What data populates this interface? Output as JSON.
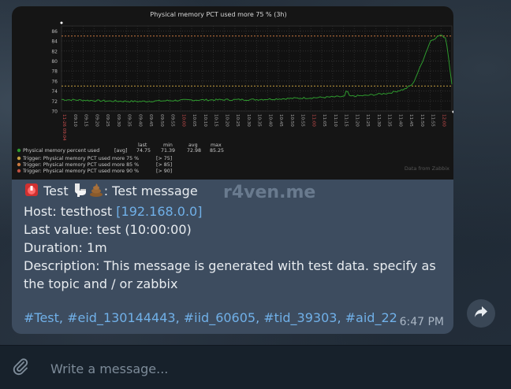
{
  "graph": {
    "title": "Physical memory PCT used more 75 % (3h)",
    "y_ticks": [
      "86",
      "84",
      "82",
      "80",
      "78",
      "76",
      "74",
      "72",
      "70"
    ],
    "x_ticks": [
      "11-26 09:04",
      "09:10",
      "09:15",
      "09:20",
      "09:25",
      "09:30",
      "09:35",
      "09:40",
      "09:45",
      "09:50",
      "09:55",
      "10:00",
      "10:05",
      "10:10",
      "10:15",
      "10:20",
      "10:25",
      "10:30",
      "10:35",
      "10:40",
      "10:45",
      "10:50",
      "10:55",
      "11:00",
      "11:05",
      "11:10",
      "11:15",
      "11:20",
      "11:25",
      "11:30",
      "11:35",
      "11:40",
      "11:45",
      "11:50",
      "11:55",
      "12:00",
      "11-26 12:04"
    ],
    "x_tick_colors": {
      "highlight": "#d05050",
      "normal": "#aaaaaa"
    },
    "stats_header": [
      "last",
      "min",
      "avg",
      "max"
    ],
    "series_label": "Physical memory percent used",
    "series_agg": "[avg]",
    "series_stats": [
      "74.75",
      "71.39",
      "72.98",
      "85.25"
    ],
    "triggers": [
      {
        "label": "Trigger: Physical memory PCT used more 75 %",
        "value": "[> 75]",
        "color": "#c8a040"
      },
      {
        "label": "Trigger: Physical memory PCT used more 85 %",
        "value": "[> 85]",
        "color": "#c87840"
      },
      {
        "label": "Trigger: Physical memory PCT used more 90 %",
        "value": "[> 90]",
        "color": "#c05040"
      }
    ],
    "footer": "Data from Zabbix",
    "series_color": "#2e9a2e"
  },
  "chart_data": {
    "type": "line",
    "title": "Physical memory PCT used more 75 % (3h)",
    "xlabel": "",
    "ylabel": "",
    "ylim": [
      70,
      87
    ],
    "x": [
      "11-26 09:04",
      "09:30",
      "10:00",
      "10:30",
      "11:00",
      "11:20",
      "11:30",
      "11:40",
      "11:45",
      "11:50",
      "11:55",
      "12:00",
      "11-26 12:04"
    ],
    "series": [
      {
        "name": "Physical memory percent used",
        "values": [
          72.3,
          71.9,
          72.2,
          72.3,
          72.7,
          73.0,
          73.5,
          74.0,
          75.0,
          79.0,
          84.0,
          85.2,
          75.5
        ]
      }
    ],
    "thresholds": [
      75,
      85
    ],
    "grid": true,
    "legend": "bottom"
  },
  "message": {
    "title_text": "Test",
    "title_suffix": ": Test message",
    "host_label": "Host: testhost ",
    "host_ip": "[192.168.0.0]",
    "last_value": "Last value: test (10:00:00)",
    "duration": "Duration: 1m",
    "description": "Description: This message is generated with test data. specify as the topic and / or zabbix",
    "hashtags": [
      {
        "text": "#Test"
      },
      {
        "text": "#eid_130144443"
      },
      {
        "text": "#iid_60605"
      },
      {
        "text": "#tid_39303"
      },
      {
        "text": "#aid_22"
      }
    ],
    "time": "6:47 PM",
    "watermark": "r4ven.me"
  },
  "composer": {
    "placeholder": "Write a message..."
  },
  "icons": {
    "siren": "siren-icon",
    "toilet": "toilet-icon",
    "poop": "poop-icon",
    "forward": "forward-icon",
    "attach": "paperclip-icon"
  }
}
